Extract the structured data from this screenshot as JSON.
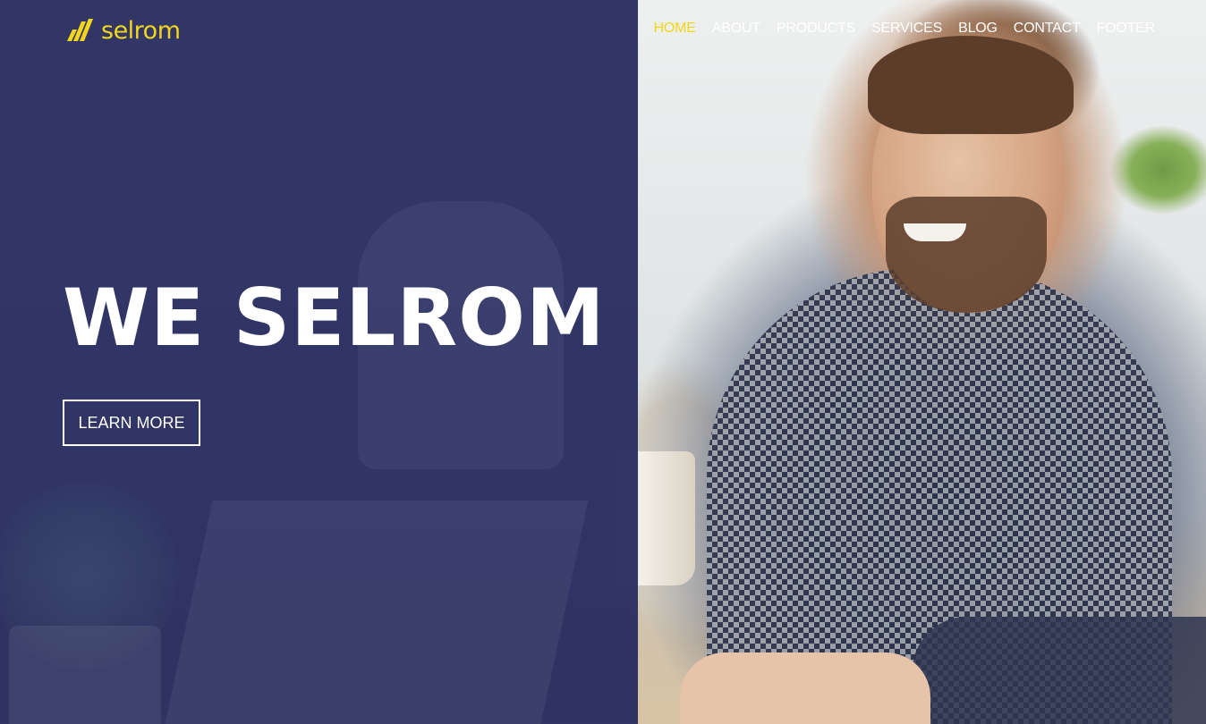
{
  "brand": {
    "name": "selrom",
    "logo_icon": "slash-bars-icon",
    "accent_color": "#f2d61c"
  },
  "nav": {
    "items": [
      {
        "label": "HOME",
        "active": true
      },
      {
        "label": "ABOUT",
        "active": false
      },
      {
        "label": "PRODUCTS",
        "active": false
      },
      {
        "label": "SERVICES",
        "active": false
      },
      {
        "label": "BLOG",
        "active": false
      },
      {
        "label": "CONTACT",
        "active": false
      },
      {
        "label": "FOOTER",
        "active": false
      }
    ]
  },
  "hero": {
    "title": "WE SELROM",
    "button_label": "LEARN MORE",
    "overlay_color": "#24285c"
  }
}
